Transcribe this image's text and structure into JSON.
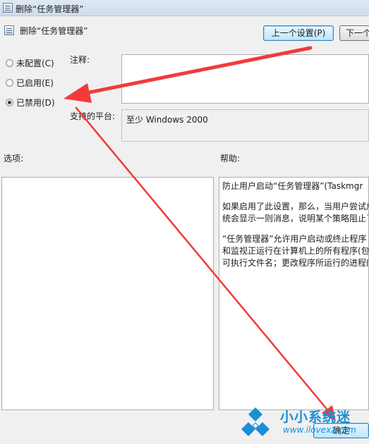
{
  "window": {
    "title": "删除“任务管理器”"
  },
  "header": {
    "policy_title": "删除“任务管理器”"
  },
  "buttons": {
    "prev_setting": "上一个设置(P)",
    "next_setting": "下一个",
    "ok": "确定"
  },
  "state_options": [
    {
      "label": "未配置(C)",
      "checked": false
    },
    {
      "label": "已启用(E)",
      "checked": false
    },
    {
      "label": "已禁用(D)",
      "checked": true
    }
  ],
  "labels": {
    "comment": "注释:",
    "supported_on": "支持的平台:",
    "options": "选项:",
    "help": "帮助:"
  },
  "supported_on_value": "至少 Windows 2000",
  "help_text": [
    "防止用户启动“任务管理器”(Taskmgr",
    "如果启用了此设置，那么，当用户尝试启",
    "统会显示一则消息，说明某个策略阻止了",
    "“任务管理器”允许用户启动或终止程序",
    "和监视正运行在计算机上的所有程序(包",
    "可执行文件名；更改程序所运行的进程的"
  ],
  "watermark": {
    "name": "小小系统迷",
    "url": "www.ilovexz.com"
  },
  "colors": {
    "annotation_arrow": "#f23a3a",
    "watermark": "#1b8fd6"
  }
}
